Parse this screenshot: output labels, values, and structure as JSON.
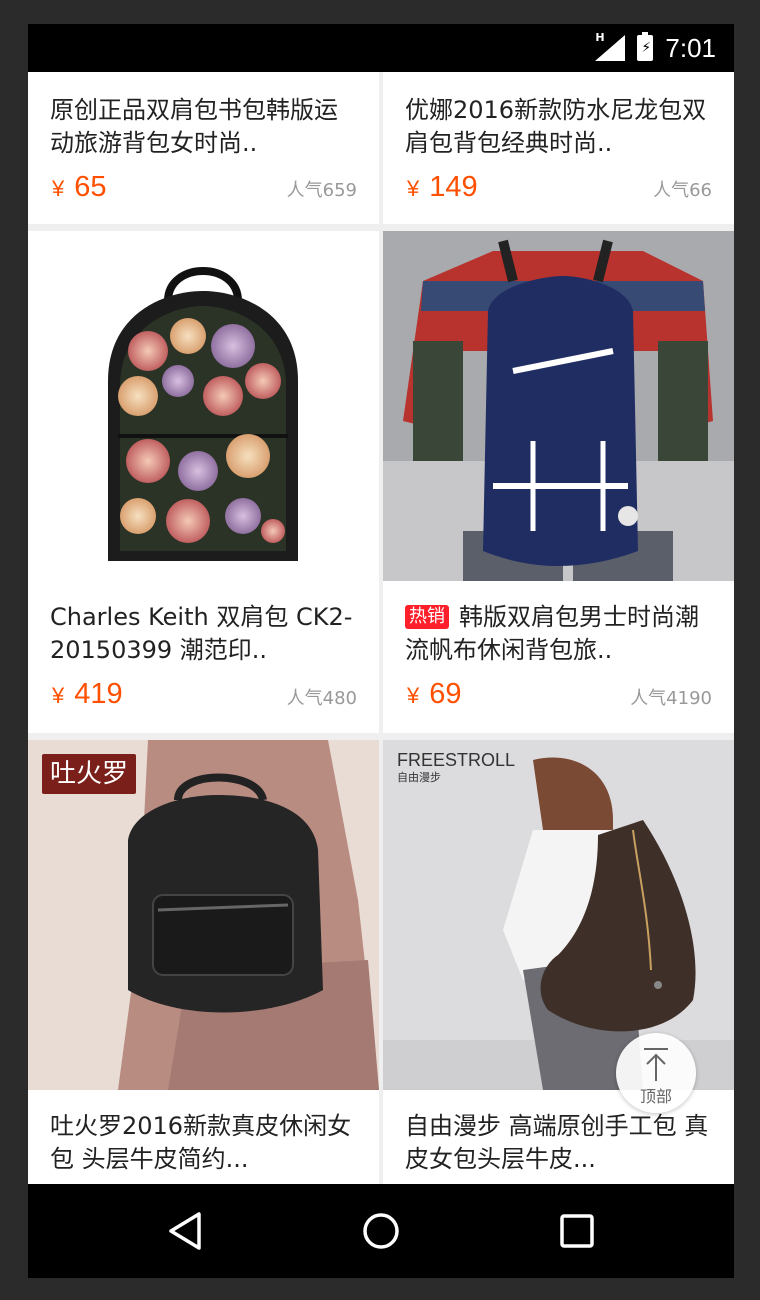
{
  "status_bar": {
    "network": "H",
    "time": "7:01"
  },
  "products": [
    {
      "title": "原创正品双肩包书包韩版运动旅游背包女时尚..",
      "price_symbol": "¥",
      "price": "65",
      "popularity": "人气659"
    },
    {
      "title": "优娜2016新款防水尼龙包双肩包背包经典时尚..",
      "price_symbol": "¥",
      "price": "149",
      "popularity": "人气66"
    },
    {
      "title": "Charles Keith 双肩包 CK2-20150399 潮范印..",
      "price_symbol": "¥",
      "price": "419",
      "popularity": "人气480"
    },
    {
      "badge": "热销",
      "title": "韩版双肩包男士时尚潮流帆布休闲背包旅..",
      "price_symbol": "¥",
      "price": "69",
      "popularity": "人气4190"
    },
    {
      "image_text": "吐火罗",
      "title": "吐火罗2016新款真皮休闲女包 头层牛皮简约..."
    },
    {
      "image_text": "FREESTROLL",
      "image_subtext": "自由漫步",
      "title": "自由漫步 高端原创手工包 真皮女包头层牛皮..."
    }
  ],
  "to_top": {
    "label": "顶部"
  },
  "colors": {
    "price": "#ff5000",
    "badge": "#ff1f2b",
    "background": "#efefef"
  }
}
